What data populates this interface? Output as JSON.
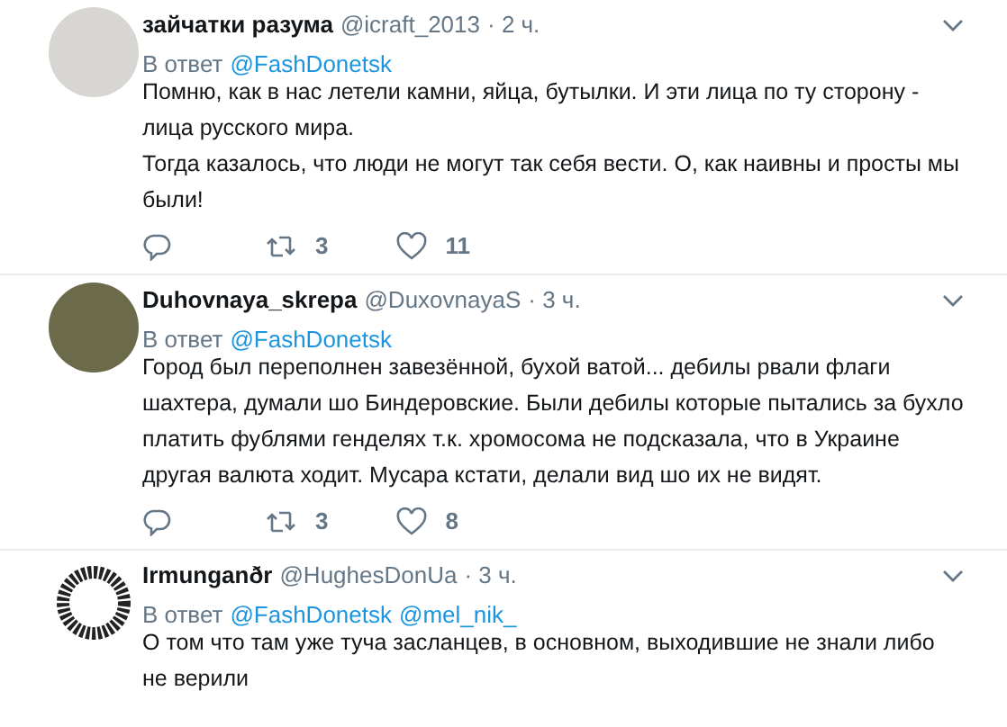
{
  "tweets": [
    {
      "name": "зайчатки разума",
      "handle": "@icraft_2013",
      "time": "· 2 ч.",
      "reply_label": "В ответ",
      "reply_to": [
        "@FashDonetsk"
      ],
      "kind": "sketch",
      "body": [
        "Помню, как в нас летели камни, яйца, бутылки. И эти лица по ту сторону -",
        "лица русского мира.",
        "Тогда казалось, что люди не могут так себя вести. О, как наивны и просты мы",
        "были!"
      ],
      "retweets": "3",
      "likes": "11"
    },
    {
      "name": "Duhovnaya_skrepa",
      "handle": "@DuxovnayaS",
      "time": "· 3 ч.",
      "reply_label": "В ответ",
      "reply_to": [
        "@FashDonetsk"
      ],
      "kind": "photo",
      "body": [
        "Город был переполнен завезённой, бухой ватой... дебилы рвали флаги",
        "шахтера, думали шо Биндеровские. Были дебилы которые пытались за бухло",
        "платить фублями генделях т.к. хромосома не подсказала, что в Украине",
        "другая валюта ходит. Мусара кстати, делали вид шо их не видят."
      ],
      "retweets": "3",
      "likes": "8"
    },
    {
      "name": "Irmunganðr",
      "handle": "@HughesDonUa",
      "time": "· 3 ч.",
      "reply_label": "В ответ",
      "reply_to": [
        "@FashDonetsk",
        "@mel_nik_"
      ],
      "kind": "logo",
      "body": [
        "О том что там уже туча засланцев, в основном, выходившие не знали либо",
        "не верили"
      ]
    }
  ]
}
